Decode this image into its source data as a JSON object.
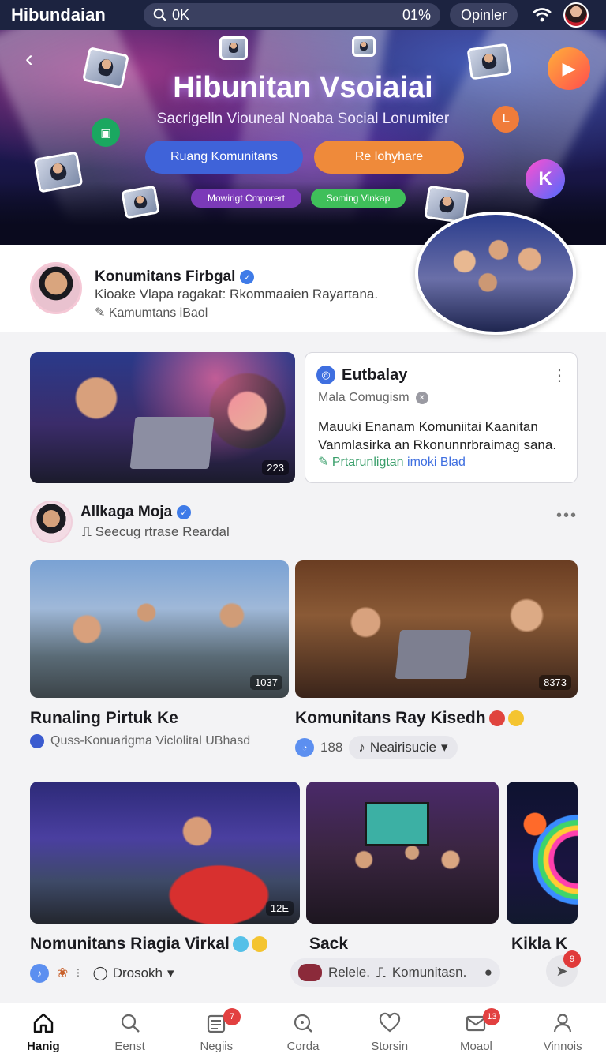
{
  "topbar": {
    "app_title": "Hibundaian",
    "search_text": "0K",
    "search_pct": "01%",
    "opinion_label": "Opinler"
  },
  "hero": {
    "title": "Hibunitan Vsoiaiai",
    "subtitle": "Sacrigelln Viouneal Noaba Social Lonumiter",
    "primary_button": "Ruang Komunitans",
    "secondary_button": "Re lohyhare",
    "chip_purple": "Mowirigt Cmporert",
    "chip_green": "Soming Vinkap"
  },
  "profile": {
    "name": "Konumitans Firbgal",
    "description": "Kioake Vlapa ragakat: Rkommaaien Rayartana.",
    "meta": "Kamumtans iBaol"
  },
  "post_card": {
    "title": "Eutbalay",
    "subtitle": "Mala Comugism",
    "body": "Mauuki Enanam Komuniitai Kaanitan Vanmlasirka an Rkonunnrbraimag sana.",
    "link_green": "Prtarunligtan",
    "link_blue": "imoki Blad",
    "image_count": "223"
  },
  "author": {
    "name": "Allkaga Moja",
    "subtitle": "Seecug rtrase Reardal"
  },
  "feed": {
    "card1": {
      "caption": "Runaling Pirtuk Ke",
      "sub": "Quss-Konuarigma Viclolital UBhasd",
      "count": "1037"
    },
    "card2": {
      "caption": "Komunitans Ray Kisedh",
      "count_text": "188",
      "pill_label": "Neairisucie",
      "count": "8373"
    },
    "card3": {
      "caption": "Nomunitans Riagia Virkal",
      "dropdown": "Drosokh",
      "count": "12E"
    },
    "card4": {
      "caption": "Sack",
      "reply": "Relele.",
      "community": "Komunitasn."
    },
    "card5": {
      "caption": "Kikla K",
      "badge": "9"
    }
  },
  "bottom_nav": [
    {
      "label": "Hanig",
      "icon": "home-icon"
    },
    {
      "label": "Eenst",
      "icon": "search-icon"
    },
    {
      "label": "Negiis",
      "icon": "news-icon",
      "badge": "7"
    },
    {
      "label": "Corda",
      "icon": "explore-icon"
    },
    {
      "label": "Storsin",
      "icon": "heart-icon"
    },
    {
      "label": "Moaol",
      "icon": "mail-icon",
      "badge": "13"
    },
    {
      "label": "Vinnois",
      "icon": "profile-icon"
    }
  ]
}
